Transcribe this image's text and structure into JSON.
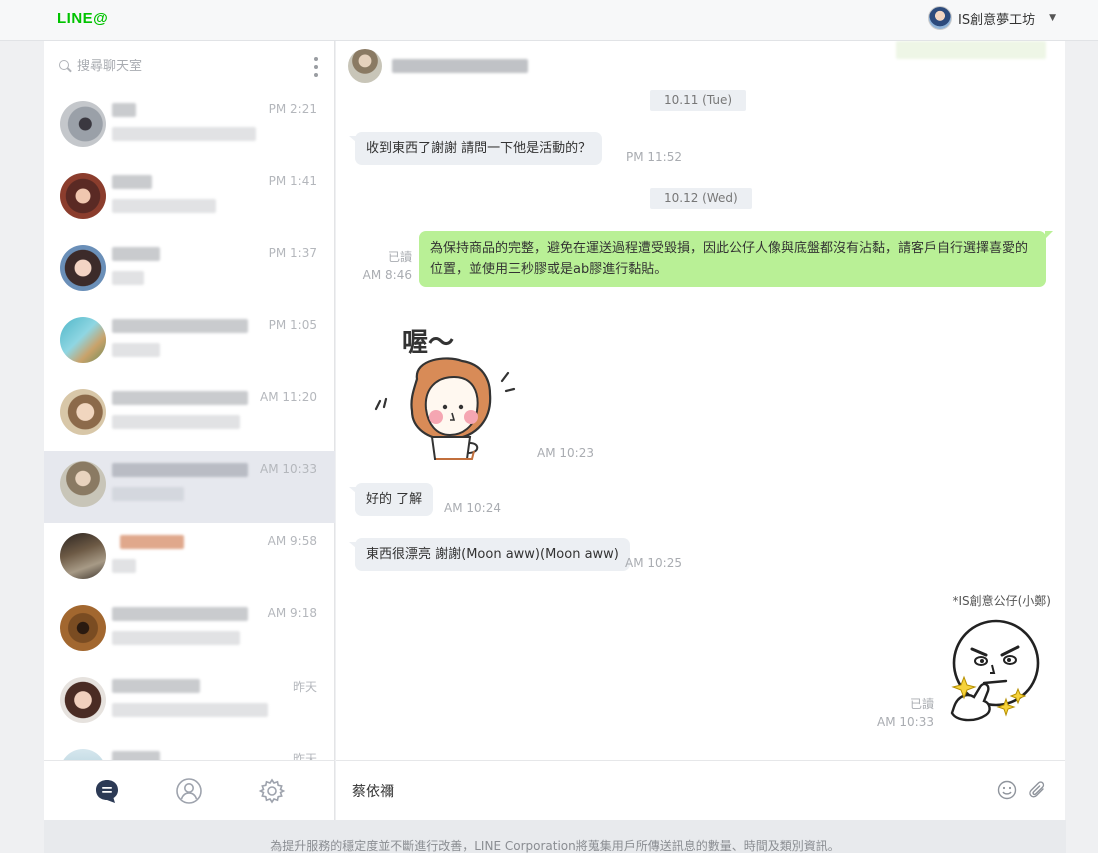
{
  "app": {
    "logo": "LINE@"
  },
  "account": {
    "name": "IS創意夢工坊"
  },
  "search": {
    "placeholder": "搜尋聊天室"
  },
  "chats": [
    {
      "time": "PM 2:21"
    },
    {
      "time": "PM 1:41"
    },
    {
      "time": "PM 1:37"
    },
    {
      "time": "PM 1:05"
    },
    {
      "time": "AM 11:20"
    },
    {
      "time": "AM 10:33"
    },
    {
      "time": "AM 9:58"
    },
    {
      "time": "AM 9:18"
    },
    {
      "time": "昨天"
    },
    {
      "time": "昨天"
    }
  ],
  "conversation": {
    "dates": [
      "10.11 (Tue)",
      "10.12 (Wed)"
    ],
    "messages": [
      {
        "text": "收到東西了謝謝 請問一下他是活動的？",
        "time": "PM 11:52"
      },
      {
        "text": "為保持商品的完整，避免在運送過程遭受毀損，因此公仔人像與底盤都沒有沾黏，請客戶自行選擇喜愛的位置，並使用三秒膠或是ab膠進行黏貼。",
        "read": "已讀",
        "time": "AM 8:46"
      },
      {
        "sticker_text": "喔～",
        "time": "AM 10:23"
      },
      {
        "text": "好的 了解",
        "time": "AM 10:24"
      },
      {
        "text": "東西很漂亮 謝謝(Moon aww)(Moon aww)",
        "time": "AM 10:25"
      },
      {
        "sender": "*IS創意公仔(小鄭)",
        "read": "已讀",
        "time": "AM 10:33"
      }
    ]
  },
  "composer": {
    "value": "蔡依禰"
  },
  "footer": {
    "text": "為提升服務的穩定度並不斷進行改善，LINE Corporation將蒐集用戶所傳送訊息的數量、時間及類別資訊。"
  }
}
